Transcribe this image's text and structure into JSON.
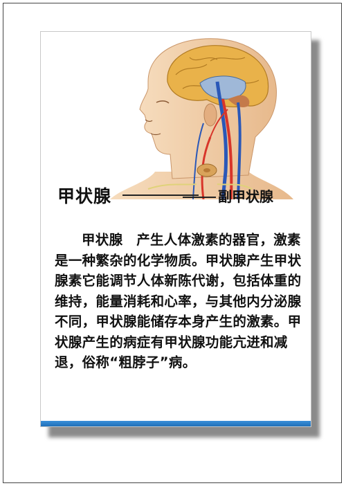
{
  "labels": {
    "left": "甲状腺",
    "right": "副甲状腺"
  },
  "paragraph": "甲状腺　产生人体激素的器官，激素是一种繁杂的化学物质。甲状腺产生甲状腺素它能调节人体新陈代谢，包括体重的维持，能量消耗和心率，与其他内分泌腺不同，甲状腺能储存本身产生的激素。甲状腺产生的病症有甲状腺功能亢进和减退，俗称“粗脖子”病。",
  "colors": {
    "accent_bar": "#1f6fb8",
    "artery": "#d8352a",
    "vein": "#2a58b8",
    "skin": "#f0c9a0",
    "brain": "#e8b44c"
  }
}
